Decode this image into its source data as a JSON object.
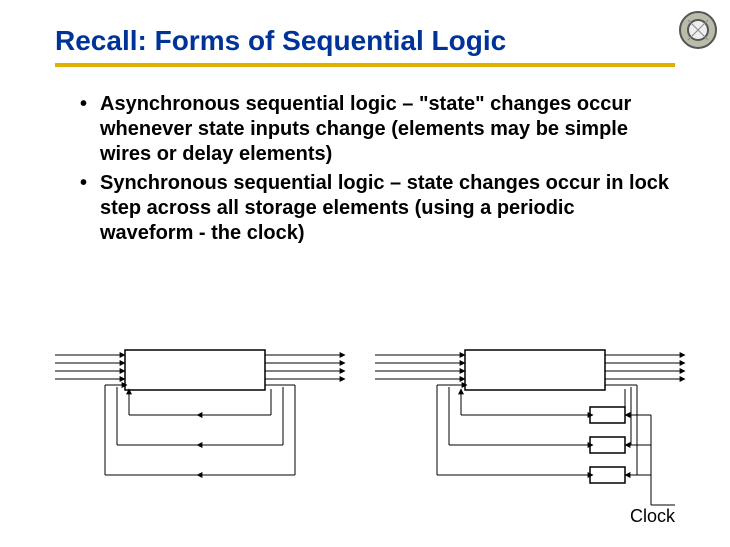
{
  "title": "Recall: Forms of Sequential Logic",
  "bullets": [
    "Asynchronous sequential logic – \"state\" changes occur whenever state inputs change (elements may be simple wires or delay elements)",
    "Synchronous sequential logic – state changes occur in lock step across all storage elements (using a periodic waveform - the clock)"
  ],
  "clock_label": "Clock"
}
